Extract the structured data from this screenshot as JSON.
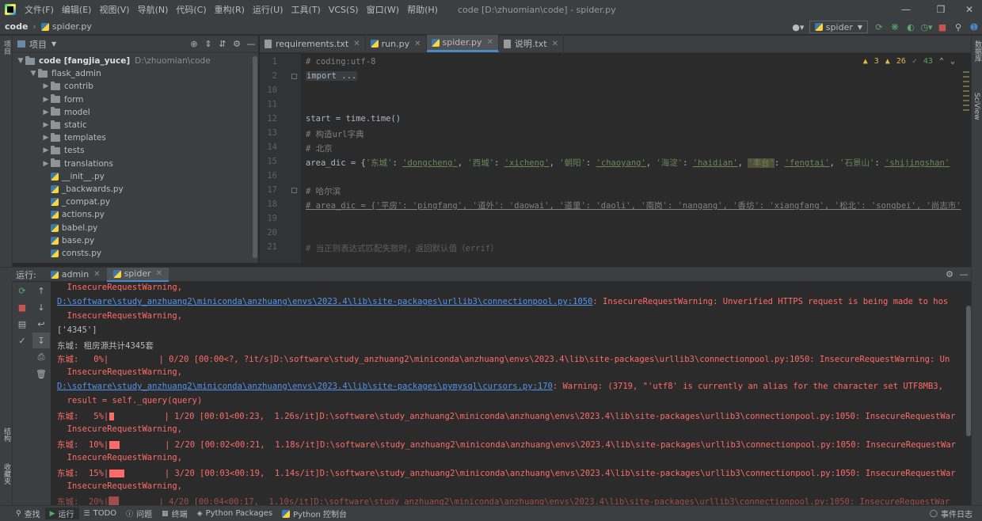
{
  "menu": [
    "文件(F)",
    "编辑(E)",
    "视图(V)",
    "导航(N)",
    "代码(C)",
    "重构(R)",
    "运行(U)",
    "工具(T)",
    "VCS(S)",
    "窗口(W)",
    "帮助(H)"
  ],
  "window_title": "code [D:\\zhuomian\\code] - spider.py",
  "breadcrumb": {
    "project": "code",
    "file": "spider.py"
  },
  "run_config": "spider",
  "left_strip": {
    "top_label": "项目",
    "bottom_label1": "结构",
    "bottom_label2": "收藏夹"
  },
  "right_strip": {
    "label1": "数据库",
    "label2": "SciView"
  },
  "project_panel": {
    "title": "项目",
    "root": {
      "name": "code [fangjia_yuce]",
      "path": "D:\\zhuomian\\code"
    },
    "tree": [
      {
        "label": "flask_admin",
        "kind": "folder-open",
        "depth": 1
      },
      {
        "label": "contrib",
        "kind": "folder",
        "depth": 2
      },
      {
        "label": "form",
        "kind": "folder",
        "depth": 2
      },
      {
        "label": "model",
        "kind": "folder",
        "depth": 2
      },
      {
        "label": "static",
        "kind": "folder",
        "depth": 2
      },
      {
        "label": "templates",
        "kind": "folder",
        "depth": 2
      },
      {
        "label": "tests",
        "kind": "folder",
        "depth": 2
      },
      {
        "label": "translations",
        "kind": "folder",
        "depth": 2
      },
      {
        "label": "__init__.py",
        "kind": "py",
        "depth": 2
      },
      {
        "label": "_backwards.py",
        "kind": "py",
        "depth": 2
      },
      {
        "label": "_compat.py",
        "kind": "py",
        "depth": 2
      },
      {
        "label": "actions.py",
        "kind": "py",
        "depth": 2
      },
      {
        "label": "babel.py",
        "kind": "py",
        "depth": 2
      },
      {
        "label": "base.py",
        "kind": "py",
        "depth": 2
      },
      {
        "label": "consts.py",
        "kind": "py",
        "depth": 2
      }
    ]
  },
  "editor_tabs": [
    {
      "label": "requirements.txt",
      "icon": "txt",
      "active": false
    },
    {
      "label": "run.py",
      "icon": "py",
      "active": false
    },
    {
      "label": "spider.py",
      "icon": "py",
      "active": true
    },
    {
      "label": "说明.txt",
      "icon": "txt",
      "active": false
    }
  ],
  "inspection": {
    "warnings1": "3",
    "warnings2": "26",
    "ok": "43"
  },
  "line_numbers": [
    "1",
    "2",
    "10",
    "11",
    "12",
    "13",
    "14",
    "15",
    "16",
    "17",
    "18",
    "19",
    "20",
    "21"
  ],
  "code": {
    "l1": "# coding:utf-8",
    "l2": "import ...",
    "l12": "start = time.time()",
    "l13": "# 构造url字典",
    "l14": "# 北京",
    "l15_pre": "area_dic = {",
    "l15_p1k": "'东城'",
    "l15_p1v": "'dongcheng'",
    "l15_p2k": "'西城'",
    "l15_p2v": "'xicheng'",
    "l15_p3k": "'朝阳'",
    "l15_p3v": "'chaoyang'",
    "l15_p4k": "'海淀'",
    "l15_p4v": "'haidian'",
    "l15_p5k": "'丰台'",
    "l15_p5v": "'fengtai'",
    "l15_p6k": "'石景山'",
    "l15_p6v": "'shijingshan'",
    "l17": "# 哈尔滨",
    "l18": "# area_dic = {'平房': 'pingfang', '道外': 'daowai', '道里': 'daoli', '南岗': 'nangang', '香坊': 'xiangfang', '松北': 'songbei', '尚志市'",
    "l21": "# 当正则表达式匹配失败时，返回默认值（errif）"
  },
  "run_panel": {
    "label": "运行:",
    "tabs": [
      {
        "label": "admin",
        "active": false
      },
      {
        "label": "spider",
        "active": true
      }
    ]
  },
  "console": {
    "c1": "  InsecureRequestWarning,",
    "c2_link": "D:\\software\\study_anzhuang2\\miniconda\\anzhuang\\envs\\2023.4\\lib\\site-packages\\urllib3\\connectionpool.py:1050",
    "c2_rest": ": InsecureRequestWarning: Unverified HTTPS request is being made to hos",
    "c3": "  InsecureRequestWarning,",
    "c4": "['4345']",
    "c5": "东城: 租房源共计4345套",
    "c6": "东城:   0%|          | 0/20 [00:00<?, ?it/s]D:\\software\\study_anzhuang2\\miniconda\\anzhuang\\envs\\2023.4\\lib\\site-packages\\urllib3\\connectionpool.py:1050: InsecureRequestWarning: Un",
    "c7": "  InsecureRequestWarning,",
    "c8_link": "D:\\software\\study_anzhuang2\\miniconda\\anzhuang\\envs\\2023.4\\lib\\site-packages\\pymysql\\cursors.py:170",
    "c8_rest": ": Warning: (3719, \"'utf8' is currently an alias for the character set UTF8MB3, ",
    "c9": "  result = self._query(query)",
    "c10_a": "东城:   5%|",
    "c10_b": "          | 1/20 [00:01<00:23,  1.26s/it]D:\\software\\study_anzhuang2\\miniconda\\anzhuang\\envs\\2023.4\\lib\\site-packages\\urllib3\\connectionpool.py:1050: InsecureRequestWar",
    "c11": "  InsecureRequestWarning,",
    "c12_a": "东城:  10%|",
    "c12_b": "         | 2/20 [00:02<00:21,  1.18s/it]D:\\software\\study_anzhuang2\\miniconda\\anzhuang\\envs\\2023.4\\lib\\site-packages\\urllib3\\connectionpool.py:1050: InsecureRequestWar",
    "c13": "  InsecureRequestWarning,",
    "c14_a": "东城:  15%|",
    "c14_b": "        | 3/20 [00:03<00:19,  1.14s/it]D:\\software\\study_anzhuang2\\miniconda\\anzhuang\\envs\\2023.4\\lib\\site-packages\\urllib3\\connectionpool.py:1050: InsecureRequestWar",
    "c15": "  InsecureRequestWarning,",
    "c16": "东城:  20%|██        | 4/20 [00:04<00:17,  1.10s/it]D:\\software\\study_anzhuang2\\miniconda\\anzhuang\\envs\\2023.4\\lib\\site-packages\\urllib3\\connectionpool.py:1050: InsecureRequestWar"
  },
  "progress": {
    "p5": 0.05,
    "p10": 0.1,
    "p15": 0.15
  },
  "statusbar": {
    "items": [
      "查找",
      "运行",
      "TODO",
      "问题",
      "终端",
      "Python Packages",
      "Python 控制台"
    ],
    "event_log": "事件日志"
  }
}
